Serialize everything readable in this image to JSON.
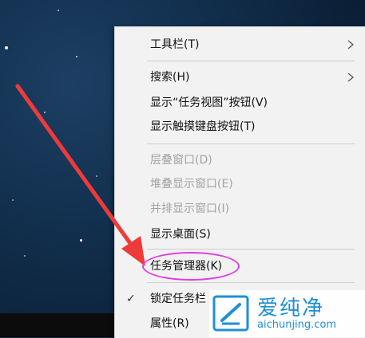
{
  "context_menu": {
    "items": [
      {
        "label": "工具栏(T)",
        "has_submenu": true,
        "enabled": true
      },
      {
        "label": "搜索(H)",
        "has_submenu": true,
        "enabled": true
      },
      {
        "label": "显示“任务视图”按钮(V)",
        "enabled": true
      },
      {
        "label": "显示触摸键盘按钮(T)",
        "enabled": true
      },
      {
        "label": "层叠窗口(D)",
        "enabled": false
      },
      {
        "label": "堆叠显示窗口(E)",
        "enabled": false
      },
      {
        "label": "并排显示窗口(I)",
        "enabled": false
      },
      {
        "label": "显示桌面(S)",
        "enabled": true
      },
      {
        "label": "任务管理器(K)",
        "enabled": true,
        "highlighted_by_annotation": true
      },
      {
        "label": "锁定任务栏",
        "enabled": true,
        "checked": true,
        "check_glyph": "✓"
      },
      {
        "label": "属性(R)",
        "enabled": true
      }
    ]
  },
  "annotation": {
    "arrow_color": "#f03a3a",
    "oval_color": "#e03ce6"
  },
  "watermark": {
    "brand": "爱纯净",
    "url": "aichunjing.com",
    "color": "#1f8fd6"
  }
}
